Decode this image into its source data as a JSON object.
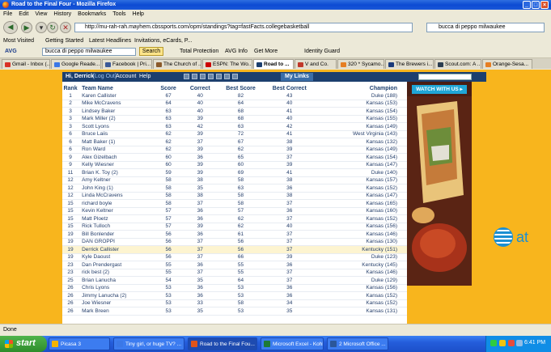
{
  "window": {
    "title": "Road to the Final Four - Mozilla Firefox"
  },
  "menu": [
    "File",
    "Edit",
    "View",
    "History",
    "Bookmarks",
    "Tools",
    "Help"
  ],
  "nav": {
    "url": "http://mu-rah-rah.mayhem.cbssports.com/opm/standings?tag=fastFacts.collegebasketball",
    "search_value": "bucca di peppo milwaukee"
  },
  "bookmarks": [
    "Most Visited",
    "Getting Started",
    "Latest Headlines",
    "Invitations, eCards, P..."
  ],
  "avg_toolbar": {
    "label": "AVG",
    "search_value": "bucca di peppo milwaukee",
    "search_button": "Search",
    "items": [
      "Total Protection",
      "AVG Info",
      "Get More",
      "Identity Guard"
    ]
  },
  "tabs": [
    {
      "label": "Gmail - Inbox (...",
      "color": "#d93025"
    },
    {
      "label": "Google Reade...",
      "color": "#3b78e7"
    },
    {
      "label": "Facebook | Pri...",
      "color": "#3b5998"
    },
    {
      "label": "The Church of ...",
      "color": "#8b5a2b"
    },
    {
      "label": "ESPN: The Wo...",
      "color": "#cc0000"
    },
    {
      "label": "Road to ...",
      "color": "#1c3f6e",
      "active": true
    },
    {
      "label": "V and Co.",
      "color": "#c0392b"
    },
    {
      "label": "320 * Sycamo...",
      "color": "#e67e22"
    },
    {
      "label": "The Brewers i...",
      "color": "#1a3a7a"
    },
    {
      "label": "Scout.com: A ...",
      "color": "#2c3e50"
    },
    {
      "label": "Orange-Sesa...",
      "color": "#e67e22"
    }
  ],
  "site": {
    "greeting": "Hi, Derrick",
    "logout": "[Log Out]",
    "account": "Account",
    "help": "Help",
    "my_links": "My Links"
  },
  "standings": {
    "columns": [
      "Rank",
      "Team Name",
      "Score",
      "Correct",
      "Best Score",
      "Best Correct",
      "Champion"
    ],
    "rows": [
      [
        "1",
        "Karen Callister",
        "67",
        "40",
        "82",
        "43",
        "Duke (188)"
      ],
      [
        "2",
        "Mike McCravens",
        "64",
        "40",
        "64",
        "40",
        "Kansas (153)"
      ],
      [
        "3",
        "Lindsey Baker",
        "63",
        "40",
        "68",
        "41",
        "Kansas (154)"
      ],
      [
        "3",
        "Mark Miller (2)",
        "63",
        "39",
        "68",
        "40",
        "Kansas (155)"
      ],
      [
        "3",
        "Scott Lyons",
        "63",
        "42",
        "63",
        "42",
        "Kansas (149)"
      ],
      [
        "6",
        "Bruce Laiis",
        "62",
        "39",
        "72",
        "41",
        "West Virginia (143)"
      ],
      [
        "6",
        "Matt Baker (1)",
        "62",
        "37",
        "67",
        "38",
        "Kansas (132)"
      ],
      [
        "6",
        "Ron Ward",
        "62",
        "39",
        "62",
        "39",
        "Kansas (149)"
      ],
      [
        "9",
        "Alex Gizelbach",
        "60",
        "36",
        "65",
        "37",
        "Kansas (154)"
      ],
      [
        "9",
        "Kelly Wiesner",
        "60",
        "39",
        "60",
        "39",
        "Kansas (147)"
      ],
      [
        "11",
        "Brian K. Toy (2)",
        "59",
        "39",
        "69",
        "41",
        "Duke (140)"
      ],
      [
        "12",
        "Amy Keltner",
        "58",
        "38",
        "58",
        "38",
        "Kansas (157)"
      ],
      [
        "12",
        "John King (1)",
        "58",
        "35",
        "63",
        "36",
        "Kansas (152)"
      ],
      [
        "12",
        "Linda McCravens",
        "58",
        "38",
        "58",
        "38",
        "Kansas (147)"
      ],
      [
        "15",
        "richard boyle",
        "58",
        "37",
        "58",
        "37",
        "Kansas (165)"
      ],
      [
        "15",
        "Kevin Keltner",
        "57",
        "36",
        "57",
        "36",
        "Kansas (160)"
      ],
      [
        "15",
        "Matt Ploetz",
        "57",
        "36",
        "62",
        "37",
        "Kansas (152)"
      ],
      [
        "15",
        "Rick Tulloch",
        "57",
        "39",
        "62",
        "40",
        "Kansas (156)"
      ],
      [
        "19",
        "Bill Bonlender",
        "56",
        "36",
        "61",
        "37",
        "Kansas (146)"
      ],
      [
        "19",
        "DAN GROPPI",
        "56",
        "37",
        "56",
        "37",
        "Kansas (130)"
      ],
      [
        "19",
        "Derrick Callister",
        "56",
        "37",
        "56",
        "37",
        "Kentucky (151)"
      ],
      [
        "19",
        "Kyle Daoust",
        "56",
        "37",
        "66",
        "39",
        "Duke (123)"
      ],
      [
        "23",
        "Dan Prendergast",
        "55",
        "36",
        "55",
        "36",
        "Kentucky (145)"
      ],
      [
        "23",
        "rick best (2)",
        "55",
        "37",
        "55",
        "37",
        "Kansas (146)"
      ],
      [
        "25",
        "Brian Lanucha",
        "54",
        "35",
        "64",
        "37",
        "Duke (129)"
      ],
      [
        "26",
        "Chris Lyons",
        "53",
        "36",
        "53",
        "36",
        "Kansas (156)"
      ],
      [
        "26",
        "Jimmy Lanucha (2)",
        "53",
        "36",
        "53",
        "36",
        "Kansas (152)"
      ],
      [
        "26",
        "Joe Wiesner",
        "53",
        "33",
        "58",
        "34",
        "Kansas (152)"
      ],
      [
        "26",
        "Mark Breen",
        "53",
        "35",
        "53",
        "35",
        "Kansas (131)"
      ]
    ],
    "highlight_row": 20
  },
  "ad": {
    "cta": "WATCH WITH US ▸",
    "brand": "at"
  },
  "status": {
    "text": "Done"
  },
  "taskbar": {
    "start": "start",
    "tasks": [
      {
        "label": "Picasa 3",
        "color": "#f4b400"
      },
      {
        "label": "Tiny girl, or huge TV? ...",
        "color": "#3b78e7"
      },
      {
        "label": "Road to the Final Fou...",
        "color": "#e0541a",
        "active": true
      },
      {
        "label": "Microsoft Excel - Kohl'...",
        "color": "#1d7a38"
      },
      {
        "label": "2 Microsoft Office ...",
        "color": "#2b579a"
      }
    ],
    "clock": "6:41 PM"
  }
}
